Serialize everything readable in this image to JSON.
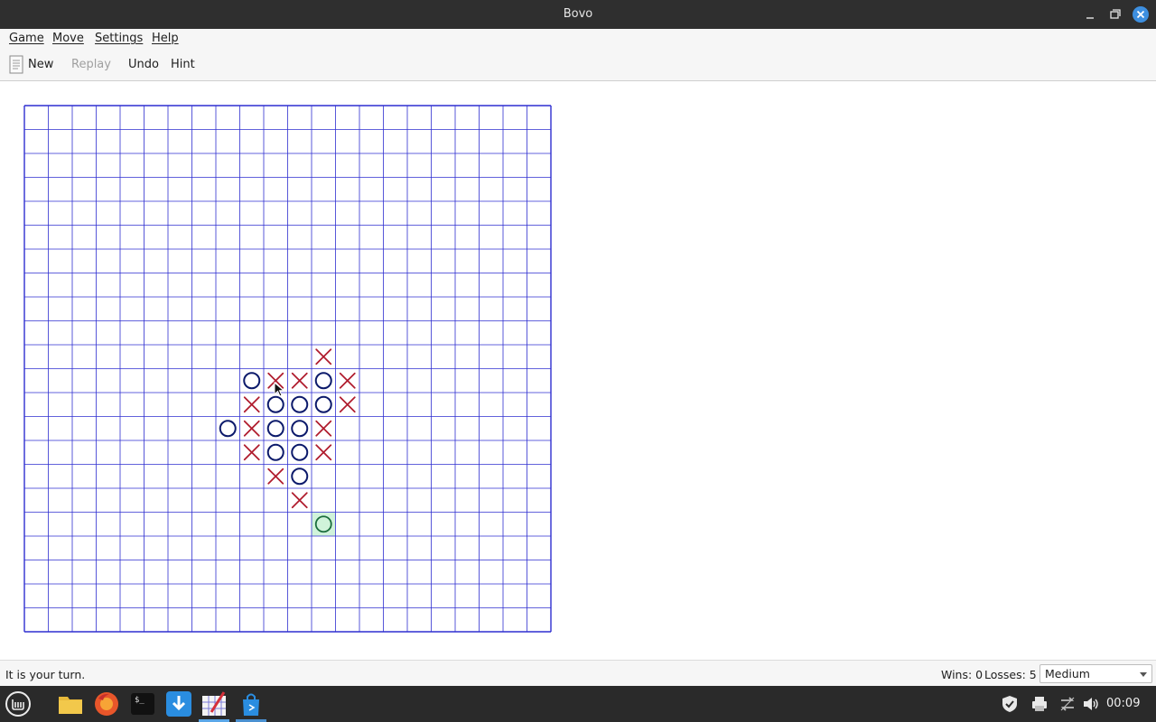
{
  "window": {
    "title": "Bovo"
  },
  "menu": {
    "items": [
      "Game",
      "Move",
      "Settings",
      "Help"
    ]
  },
  "toolbar": {
    "new_label": "New",
    "replay_label": "Replay",
    "undo_label": "Undo",
    "hint_label": "Hint"
  },
  "board": {
    "cols": 22,
    "rows": 22,
    "grid_color": "#2f2fd0",
    "x_color": "#b01c2e",
    "o_color": "#0c1a6b",
    "hint_color": "#1a6d3c",
    "hint_fill": "#d0f3da",
    "marks": [
      {
        "type": "X",
        "col": 12,
        "row": 10
      },
      {
        "type": "O",
        "col": 9,
        "row": 11
      },
      {
        "type": "X",
        "col": 10,
        "row": 11
      },
      {
        "type": "X",
        "col": 11,
        "row": 11
      },
      {
        "type": "O",
        "col": 12,
        "row": 11
      },
      {
        "type": "X",
        "col": 13,
        "row": 11
      },
      {
        "type": "X",
        "col": 9,
        "row": 12
      },
      {
        "type": "O",
        "col": 10,
        "row": 12
      },
      {
        "type": "O",
        "col": 11,
        "row": 12
      },
      {
        "type": "O",
        "col": 12,
        "row": 12
      },
      {
        "type": "X",
        "col": 13,
        "row": 12
      },
      {
        "type": "O",
        "col": 8,
        "row": 13
      },
      {
        "type": "X",
        "col": 9,
        "row": 13
      },
      {
        "type": "O",
        "col": 10,
        "row": 13
      },
      {
        "type": "O",
        "col": 11,
        "row": 13
      },
      {
        "type": "X",
        "col": 12,
        "row": 13
      },
      {
        "type": "X",
        "col": 9,
        "row": 14
      },
      {
        "type": "O",
        "col": 10,
        "row": 14
      },
      {
        "type": "O",
        "col": 11,
        "row": 14
      },
      {
        "type": "X",
        "col": 12,
        "row": 14
      },
      {
        "type": "X",
        "col": 10,
        "row": 15
      },
      {
        "type": "O",
        "col": 11,
        "row": 15
      },
      {
        "type": "X",
        "col": 11,
        "row": 16
      }
    ],
    "hint_cell": {
      "col": 12,
      "row": 17
    }
  },
  "status": {
    "message": "It is your turn.",
    "wins_label": "Wins: 0",
    "losses_label": "Losses: 5",
    "difficulty": "Medium"
  },
  "taskbar": {
    "clock": "00:09"
  }
}
